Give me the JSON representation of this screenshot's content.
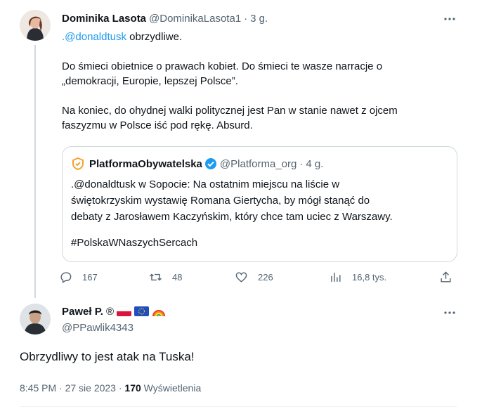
{
  "tweet1": {
    "author_name": "Dominika Lasota",
    "handle": "@DominikaLasota1",
    "time": "3 g.",
    "mention": ".@donaldtusk",
    "first_line_rest": " obrzydliwe.",
    "paragraph2": "Do śmieci obietnice o prawach kobiet. Do śmieci te wasze narracje o\n„demokracji, Europie, lepszej Polsce”.",
    "paragraph3": "Na koniec, do ohydnej walki politycznej jest Pan w stanie nawet z ojcem\nfaszyzmu w Polsce iść pod rękę. Absurd.",
    "quote": {
      "author_name": "PlatformaObywatelska",
      "handle": "@Platforma_org",
      "time": "4 g.",
      "text": ".@donaldtusk w Sopocie: Na ostatnim miejscu na liście w\nświętokrzyskim wystawię Romana Giertycha, by mógł stanąć do\ndebaty z Jarosławem Kaczyńskim, który chce tam uciec z Warszawy.",
      "hashtag": "#PolskaWNaszychSercach"
    },
    "actions": {
      "replies": "167",
      "retweets": "48",
      "likes": "226",
      "views": "16,8 tys."
    }
  },
  "tweet2": {
    "author_name": "Paweł P.",
    "registered_mark": "®",
    "handle": "@PPawlik4343",
    "text": "Obrzydliwy to jest atak na Tuska!",
    "time": "8:45 PM · 27 sie 2023 ·",
    "views_count": "170",
    "views_label": "Wyświetlenia"
  },
  "colors": {
    "accent": "#1d9bf0",
    "secondary_text": "#536471",
    "border": "#cfd9de",
    "platforma_orange": "#f2a32f"
  }
}
